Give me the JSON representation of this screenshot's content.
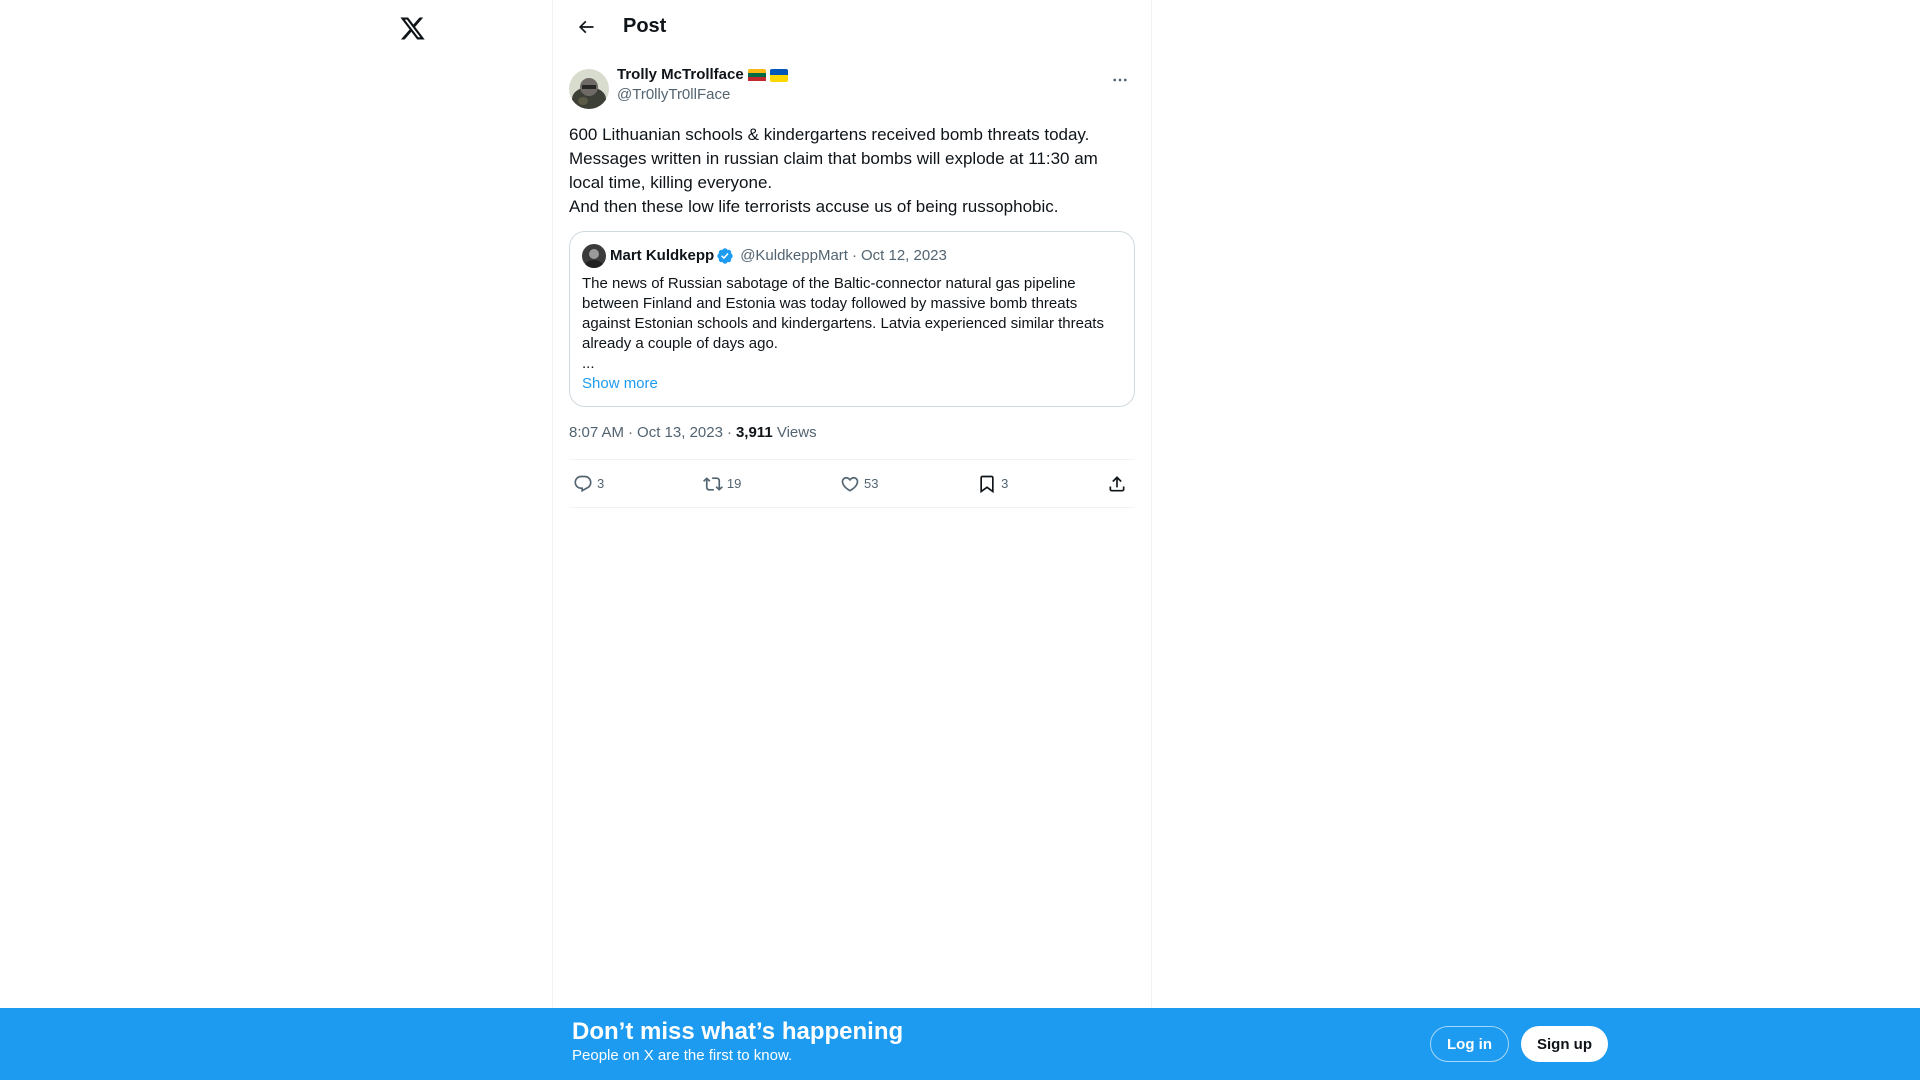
{
  "nav": {
    "logo_icon": "x-logo-icon"
  },
  "header": {
    "back_icon": "arrow-left-icon",
    "title": "Post"
  },
  "post": {
    "author": {
      "display_name": "Trolly McTrollface",
      "handle": "@Tr0llyTr0llFace",
      "flags": [
        "lithuania-flag",
        "ukraine-flag"
      ]
    },
    "text": "600 Lithuanian schools & kindergartens received bomb threats today.\nMessages written in russian claim that bombs will explode at 11:30 am local time, killing everyone.\nAnd then these low life terrorists accuse us of being russophobic.",
    "quote": {
      "display_name": "Mart Kuldkepp",
      "handle": "@KuldkeppMart",
      "date": "Oct 12, 2023",
      "verified": true,
      "text": "The news of Russian sabotage of the Baltic-connector natural gas pipeline between Finland and Estonia was today followed by massive bomb threats against Estonian schools and kindergartens. Latvia experienced similar threats already a couple of days ago.",
      "ellipsis": "...",
      "show_more": "Show more"
    },
    "time": "8:07 AM",
    "date": "Oct 13, 2023",
    "views_count": "3,911",
    "views_label": "Views",
    "stats": {
      "replies": "3",
      "reposts": "19",
      "likes": "53",
      "bookmarks": "3"
    }
  },
  "banner": {
    "title": "Don’t miss what’s happening",
    "subtitle": "People on X are the first to know.",
    "login_label": "Log in",
    "signup_label": "Sign up"
  },
  "colors": {
    "accent": "#1d9bf0",
    "text": "#0f1419",
    "muted": "#536471",
    "border": "#eff3f4"
  }
}
